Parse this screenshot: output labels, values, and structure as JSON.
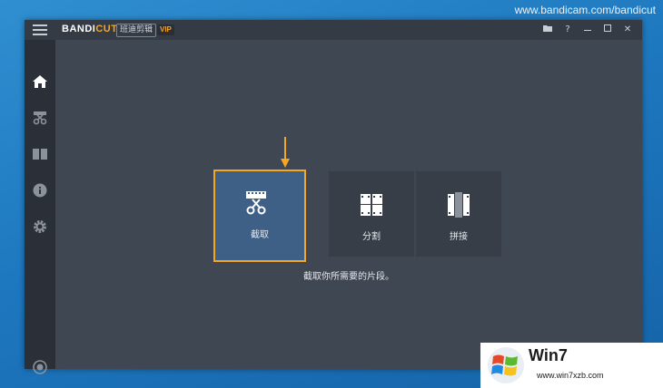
{
  "desktop": {
    "watermark_url": "www.bandicam.com/bandicut",
    "background_color": "#1e78bf"
  },
  "titlebar": {
    "logo_main": "BANDI",
    "logo_accent": "CUT",
    "app_subtitle": "班迪剪辑",
    "vip_badge": "VIP",
    "controls": [
      {
        "icon": "folder-icon",
        "glyph": "▬"
      },
      {
        "icon": "help-icon",
        "glyph": "?"
      },
      {
        "icon": "minimize-icon",
        "glyph": "—"
      },
      {
        "icon": "maximize-icon",
        "glyph": "☐"
      },
      {
        "icon": "close-icon",
        "glyph": "✕"
      }
    ]
  },
  "sidebar": {
    "items": [
      {
        "icon": "home-icon",
        "active": true
      },
      {
        "icon": "cut-scissors-icon",
        "active": false
      },
      {
        "icon": "split-film-icon",
        "active": false
      },
      {
        "icon": "info-icon",
        "active": false
      },
      {
        "icon": "settings-gear-icon",
        "active": false
      },
      {
        "icon": "record-icon",
        "active": false
      }
    ]
  },
  "main": {
    "tiles": [
      {
        "label": "截取",
        "icon": "cut-scissors-icon",
        "selected": true
      },
      {
        "label": "分割",
        "icon": "split-film-icon",
        "selected": false
      },
      {
        "label": "拼接",
        "icon": "join-film-icon",
        "selected": false
      }
    ],
    "hint": "截取你所需要的片段。"
  },
  "overlay": {
    "win7_logo_text": "Win7",
    "win7_subtext": "www.win7xzb.com"
  },
  "colors": {
    "accent": "#f5a623",
    "window_bg": "#3f4753",
    "sidebar_bg": "#2b3038",
    "tile_bg": "#373e48",
    "tile_selected_bg": "#3e5f86"
  }
}
